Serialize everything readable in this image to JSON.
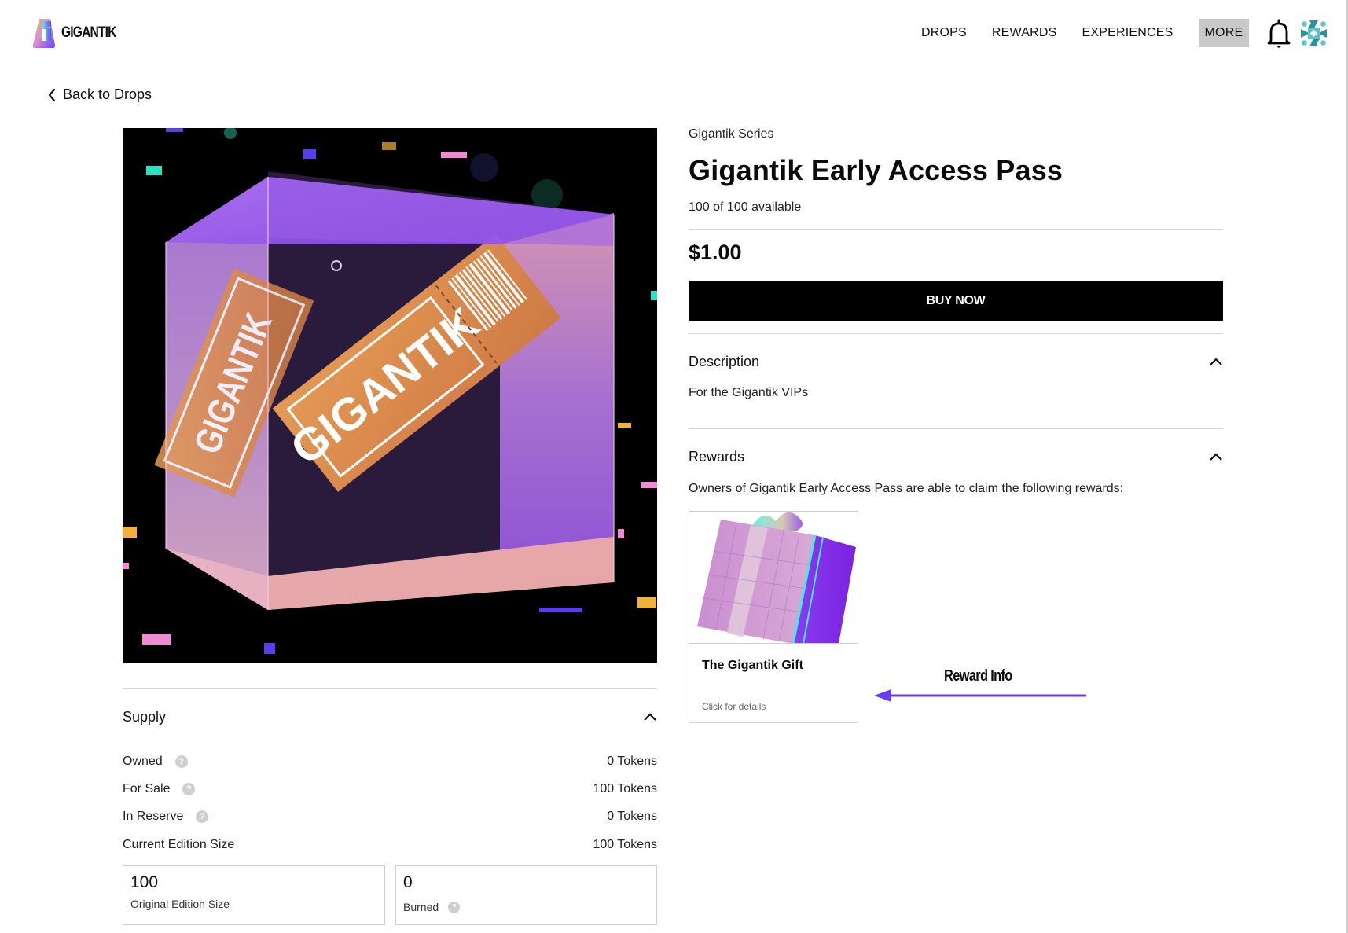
{
  "header": {
    "brand": "GIGANTIK",
    "nav": [
      {
        "label": "DROPS"
      },
      {
        "label": "REWARDS"
      },
      {
        "label": "EXPERIENCES"
      },
      {
        "label": "MORE",
        "active": true
      }
    ],
    "icons": {
      "notifications": "bell-icon",
      "profile": "avatar-identicon"
    }
  },
  "back_link": {
    "label": "Back to Drops",
    "icon": "chevron-left-icon"
  },
  "hero": {
    "alt": "Gigantik ticket inside glass cube",
    "ticket_text": "GIGANTIK"
  },
  "product": {
    "series": "Gigantik Series",
    "title": "Gigantik Early Access Pass",
    "availability": "100 of 100 available",
    "price": "$1.00",
    "buy_label": "BUY NOW"
  },
  "description": {
    "heading": "Description",
    "text": "For the Gigantik VIPs"
  },
  "rewards": {
    "heading": "Rewards",
    "intro": "Owners of Gigantik Early Access Pass are able to claim the following rewards:",
    "items": [
      {
        "name": "The Gigantik Gift",
        "hint": "Click for details"
      }
    ]
  },
  "annotation": {
    "label": "Reward Info",
    "color": "#6a3cf5"
  },
  "supply": {
    "heading": "Supply",
    "rows": [
      {
        "label": "Owned",
        "value": "0 Tokens",
        "help": true
      },
      {
        "label": "For Sale",
        "value": "100 Tokens",
        "help": true
      },
      {
        "label": "In Reserve",
        "value": "0 Tokens",
        "help": true
      },
      {
        "label": "Current Edition Size",
        "value": "100 Tokens",
        "help": false
      }
    ],
    "boxes": [
      {
        "value": "100",
        "caption": "Original Edition Size"
      },
      {
        "value": "0",
        "caption": "Burned"
      }
    ]
  },
  "colors": {
    "button_bg": "#000000",
    "nav_active_bg": "#c8c8c8",
    "divider": "#d6d6d6",
    "annotation_arrow": "#6a3cf5"
  }
}
